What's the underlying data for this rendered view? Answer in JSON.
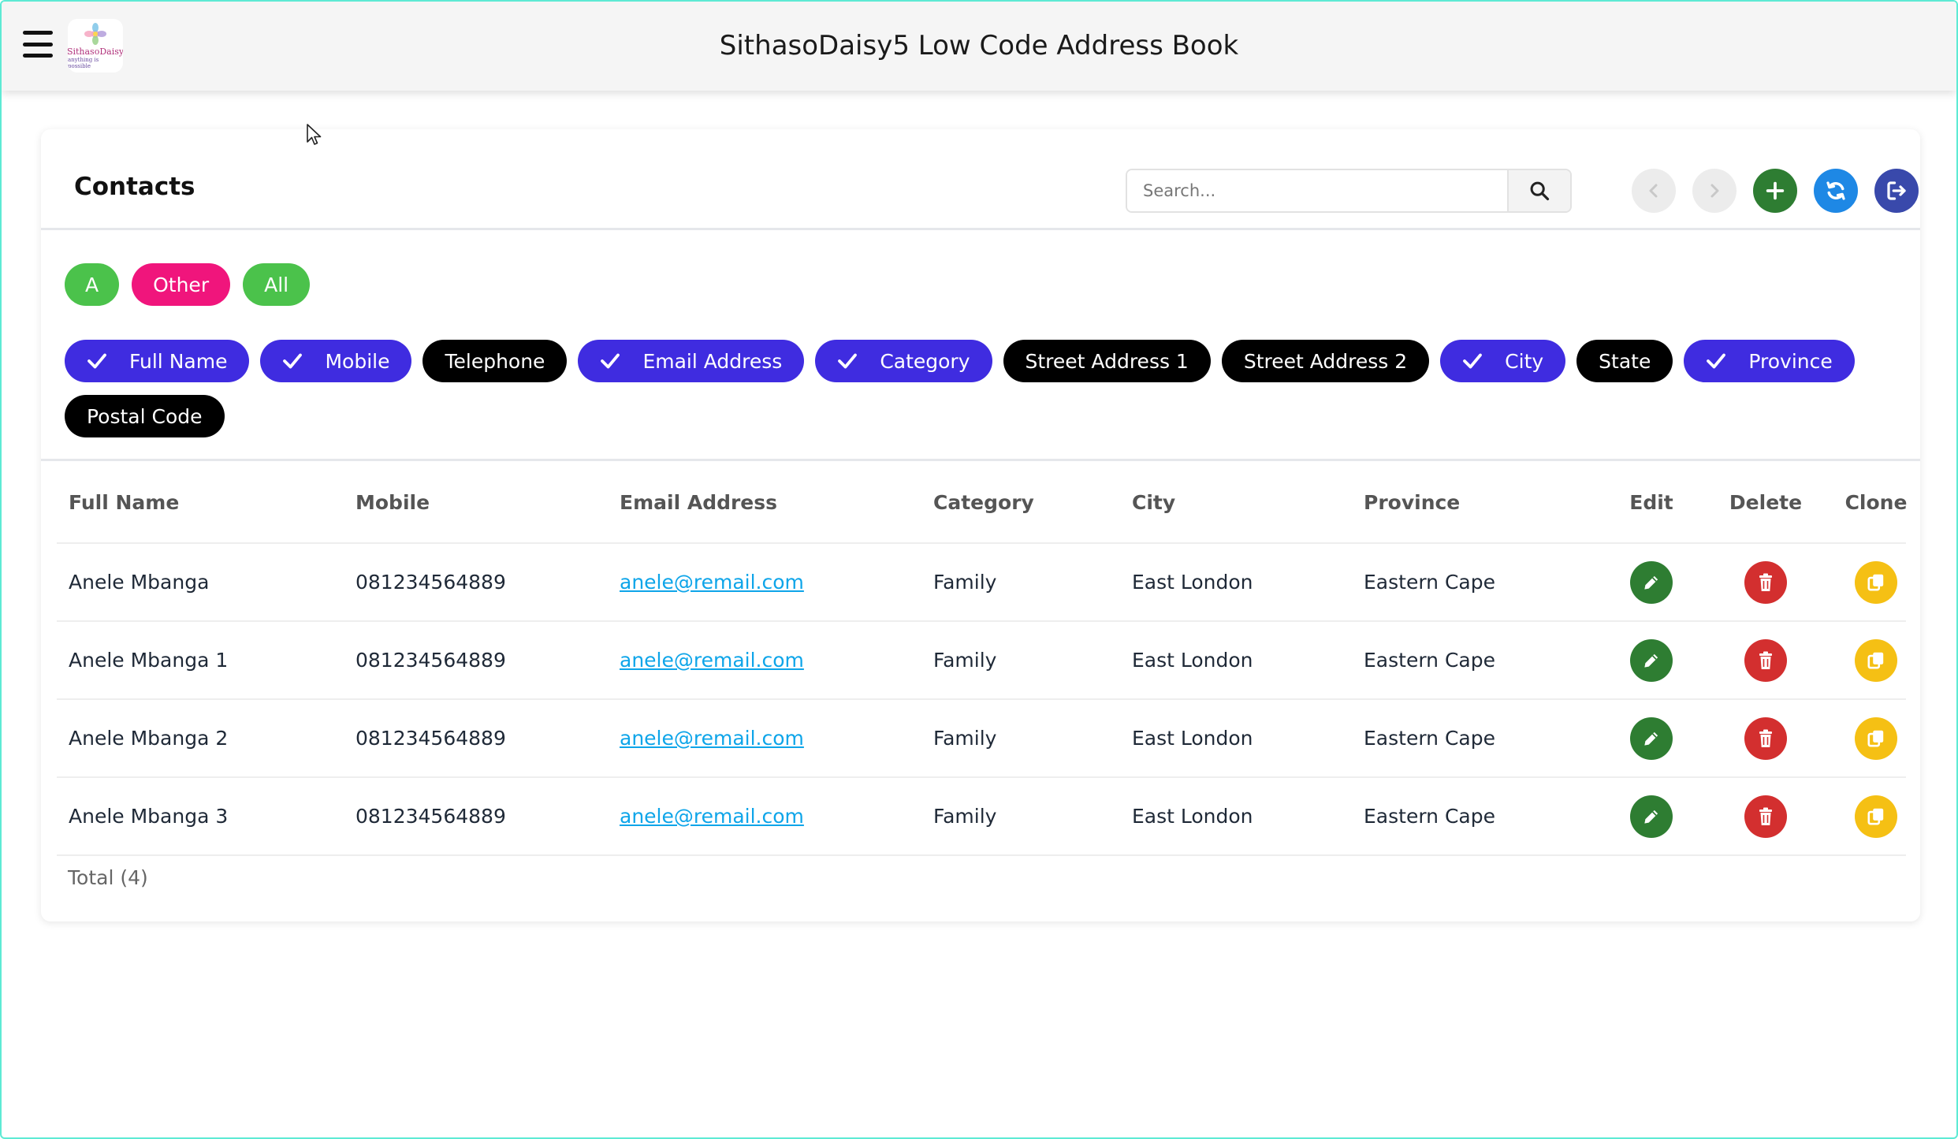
{
  "app": {
    "title": "SithasoDaisy5 Low Code Address Book",
    "logo_name": "SithasoDaisy",
    "logo_tagline": "anything is possible"
  },
  "card": {
    "title": "Contacts",
    "search_placeholder": "Search..."
  },
  "letter_filters": [
    {
      "label": "A",
      "color": "#4bc24b"
    },
    {
      "label": "Other",
      "color": "#f0157c"
    },
    {
      "label": "All",
      "color": "#4bc24b"
    }
  ],
  "column_toggles": [
    {
      "label": "Full Name",
      "checked": true
    },
    {
      "label": "Mobile",
      "checked": true
    },
    {
      "label": "Telephone",
      "checked": false
    },
    {
      "label": "Email Address",
      "checked": true
    },
    {
      "label": "Category",
      "checked": true
    },
    {
      "label": "Street Address 1",
      "checked": false
    },
    {
      "label": "Street Address 2",
      "checked": false
    },
    {
      "label": "City",
      "checked": true
    },
    {
      "label": "State",
      "checked": false
    },
    {
      "label": "Province",
      "checked": true
    },
    {
      "label": "Postal Code",
      "checked": false
    }
  ],
  "table": {
    "headers": {
      "full_name": "Full Name",
      "mobile": "Mobile",
      "email": "Email Address",
      "category": "Category",
      "city": "City",
      "province": "Province",
      "edit": "Edit",
      "delete": "Delete",
      "clone": "Clone"
    },
    "rows": [
      {
        "full_name": "Anele Mbanga",
        "mobile": "081234564889",
        "email": "anele@remail.com",
        "category": "Family",
        "city": "East London",
        "province": "Eastern Cape"
      },
      {
        "full_name": "Anele Mbanga 1",
        "mobile": "081234564889",
        "email": "anele@remail.com",
        "category": "Family",
        "city": "East London",
        "province": "Eastern Cape"
      },
      {
        "full_name": "Anele Mbanga 2",
        "mobile": "081234564889",
        "email": "anele@remail.com",
        "category": "Family",
        "city": "East London",
        "province": "Eastern Cape"
      },
      {
        "full_name": "Anele Mbanga 3",
        "mobile": "081234564889",
        "email": "anele@remail.com",
        "category": "Family",
        "city": "East London",
        "province": "Eastern Cape"
      }
    ],
    "total_label": "Total (4)"
  },
  "colors": {
    "chip_checked": "#3f2ce0",
    "chip_unchecked": "#000000",
    "edit": "#2e7d32",
    "delete": "#d32f2f",
    "clone": "#f5c014",
    "link": "#0ea5e9"
  },
  "icons": {
    "menu": "hamburger-menu-icon",
    "search": "search-icon",
    "prev": "chevron-left-icon",
    "next": "chevron-right-icon",
    "add": "plus-icon",
    "refresh": "refresh-icon",
    "logout": "logout-icon",
    "edit": "pencil-icon",
    "delete": "trash-icon",
    "clone": "copy-icon",
    "check": "check-icon"
  }
}
